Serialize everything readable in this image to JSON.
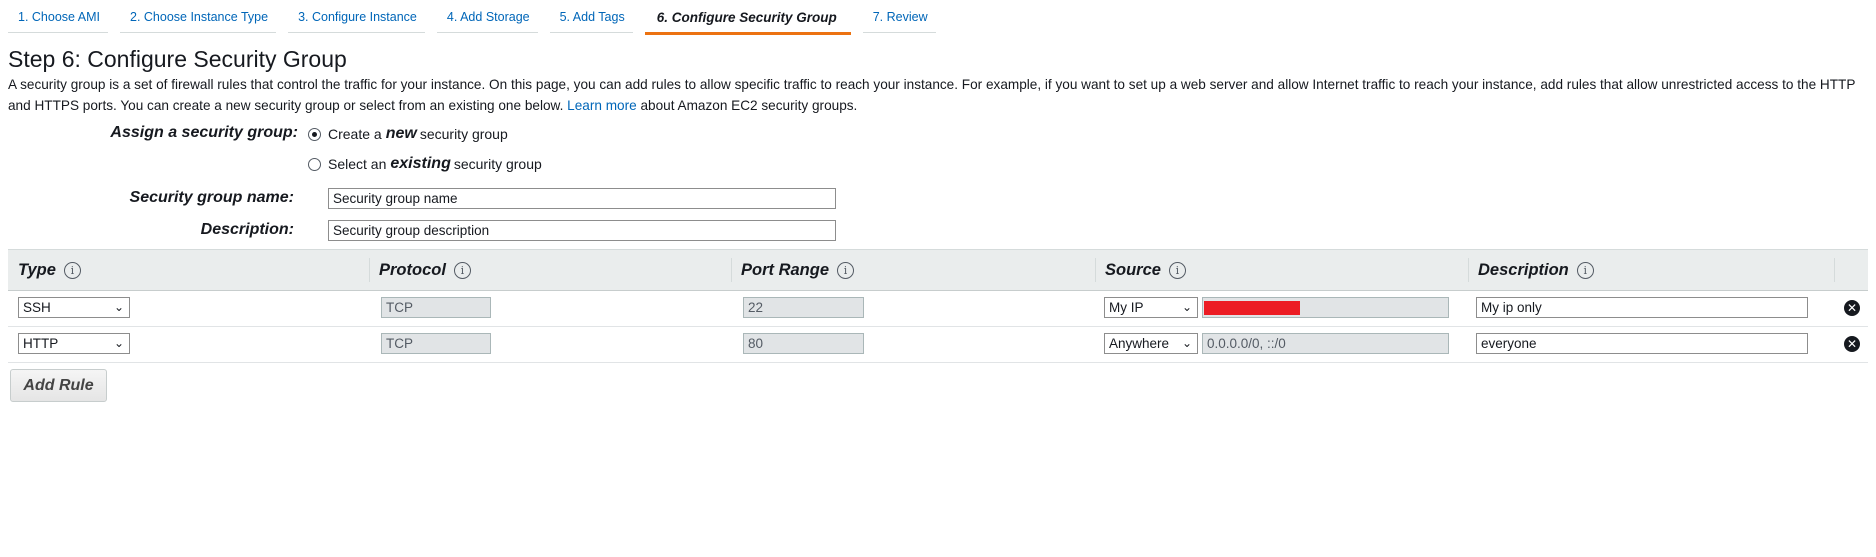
{
  "wizard": {
    "tabs": [
      {
        "label": "1. Choose AMI"
      },
      {
        "label": "2. Choose Instance Type"
      },
      {
        "label": "3. Configure Instance"
      },
      {
        "label": "4. Add Storage"
      },
      {
        "label": "5. Add Tags"
      },
      {
        "label": "6. Configure Security Group"
      },
      {
        "label": "7. Review"
      }
    ],
    "active_tab_index": 5
  },
  "page": {
    "title": "Step 6: Configure Security Group",
    "intro_text": "A security group is a set of firewall rules that control the traffic for your instance. On this page, you can add rules to allow specific traffic to reach your instance. For example, if you want to set up a web server and allow Internet traffic to reach your instance, add rules that allow unrestricted access to the HTTP and HTTPS ports. You can create a new security group or select from an existing one below.",
    "learn_more_link": "Learn more",
    "intro_suffix": "about Amazon EC2 security groups."
  },
  "assign": {
    "label": "Assign a security group:",
    "option_new_prefix": "Create a",
    "option_new_emph": "new",
    "option_new_suffix": "security group",
    "option_existing_prefix": "Select an",
    "option_existing_emph": "existing",
    "option_existing_suffix": "security group",
    "selected": "new"
  },
  "form": {
    "name_label": "Security group name:",
    "name_value": "Security group name",
    "description_label": "Description:",
    "description_value": "Security group description"
  },
  "table": {
    "headers": {
      "type": "Type",
      "protocol": "Protocol",
      "port_range": "Port Range",
      "source": "Source",
      "description": "Description"
    },
    "info_icon": "i",
    "rows": [
      {
        "type": "SSH",
        "protocol": "TCP",
        "port": "22",
        "source_type": "My IP",
        "source_value": "",
        "source_redacted": true,
        "description": "My ip only"
      },
      {
        "type": "HTTP",
        "protocol": "TCP",
        "port": "80",
        "source_type": "Anywhere",
        "source_value": "0.0.0.0/0, ::/0",
        "source_redacted": false,
        "description": "everyone"
      }
    ]
  },
  "actions": {
    "add_rule": "Add Rule"
  },
  "colors": {
    "accent_tab": "#ec7211",
    "link": "#0066b8",
    "redaction": "#ec1c24"
  }
}
